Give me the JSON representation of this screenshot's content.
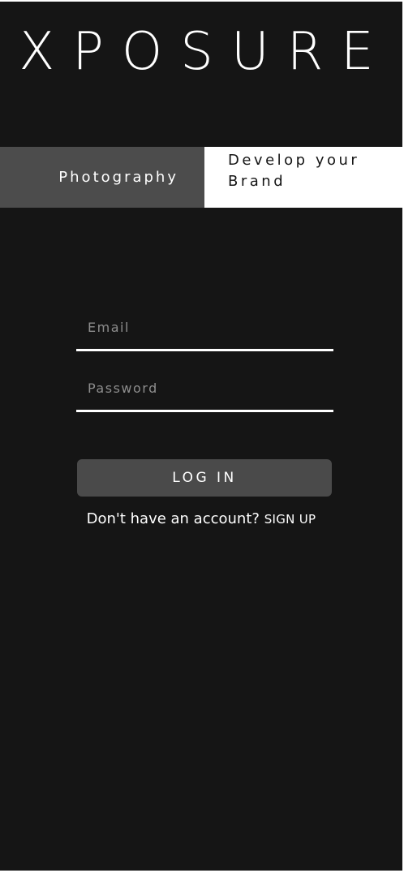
{
  "app": {
    "logo_text": "XPOSURE"
  },
  "tabs": {
    "photography_label": "Photography",
    "brand_label_line1": "Develop your",
    "brand_label_line2": "Brand"
  },
  "login_form": {
    "email_placeholder": "Email",
    "email_value": "",
    "password_placeholder": "Password",
    "password_value": "",
    "login_button_label": "LOG IN",
    "signup_prompt": "Don't have an account?",
    "signup_link_label": "SIGN UP"
  },
  "colors": {
    "background": "#151515",
    "tab_active": "#4c4c4c",
    "tab_inactive": "#ffffff",
    "button": "#4a4a4a",
    "text": "#ffffff"
  }
}
